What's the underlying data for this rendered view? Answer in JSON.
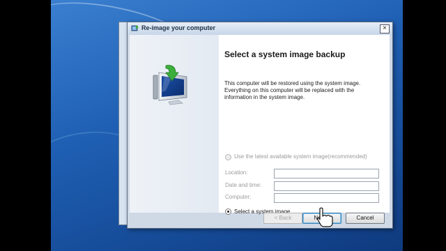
{
  "window": {
    "title": "Re-image your computer",
    "close_glyph": "×"
  },
  "page": {
    "heading": "Select a system image backup",
    "description_lines": [
      "This computer will be restored using the system image.",
      "Everything on this computer will be replaced with the",
      "information in the system image."
    ],
    "option_latest": {
      "label": "Use the latest available system image(recommended)",
      "selected": false,
      "enabled": false
    },
    "fields": {
      "location": {
        "label": "Location:",
        "value": ""
      },
      "date_time": {
        "label": "Date and time:",
        "value": ""
      },
      "computer": {
        "label": "Computer:",
        "value": ""
      }
    },
    "option_select": {
      "label": "Select a system image",
      "selected": true
    }
  },
  "buttons": {
    "back": "< Back",
    "next": "Next >",
    "cancel": "Cancel"
  },
  "icons": {
    "title": "backup-restore-icon",
    "illustration": "monitor-with-green-arrow-icon",
    "cursor": "hand-pointer-icon"
  },
  "colors": {
    "desktop": "#1f5fb3",
    "titlebar": "#c7d6e8",
    "default_button_border": "#3c7fb1"
  }
}
